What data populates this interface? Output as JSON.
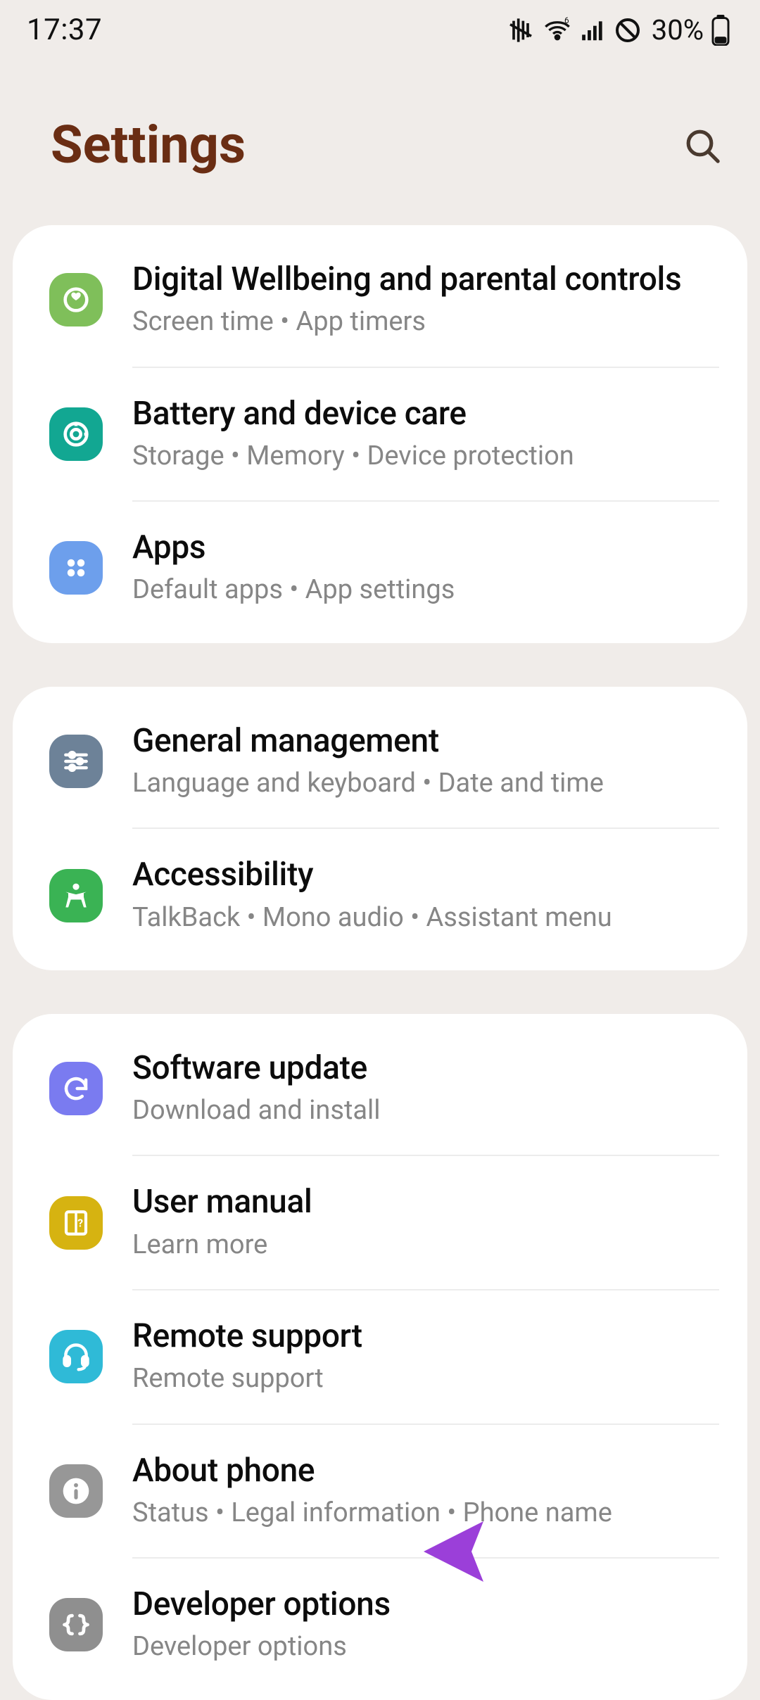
{
  "status": {
    "time": "17:37",
    "battery_percent": "30%"
  },
  "header": {
    "title": "Settings"
  },
  "groups": [
    {
      "items": [
        {
          "key": "wellbeing",
          "title": "Digital Wellbeing and parental controls",
          "subtitle": "Screen time  •  App timers"
        },
        {
          "key": "battery",
          "title": "Battery and device care",
          "subtitle": "Storage  •  Memory  •  Device protection"
        },
        {
          "key": "apps",
          "title": "Apps",
          "subtitle": "Default apps  •  App settings"
        }
      ]
    },
    {
      "items": [
        {
          "key": "general",
          "title": "General management",
          "subtitle": "Language and keyboard  •  Date and time"
        },
        {
          "key": "access",
          "title": "Accessibility",
          "subtitle": "TalkBack  •  Mono audio  •  Assistant menu"
        }
      ]
    },
    {
      "items": [
        {
          "key": "software",
          "title": "Software update",
          "subtitle": "Download and install"
        },
        {
          "key": "manual",
          "title": "User manual",
          "subtitle": "Learn more"
        },
        {
          "key": "remote",
          "title": "Remote support",
          "subtitle": "Remote support"
        },
        {
          "key": "about",
          "title": "About phone",
          "subtitle": "Status  •  Legal information  •  Phone name"
        },
        {
          "key": "dev",
          "title": "Developer options",
          "subtitle": "Developer options"
        }
      ]
    }
  ]
}
